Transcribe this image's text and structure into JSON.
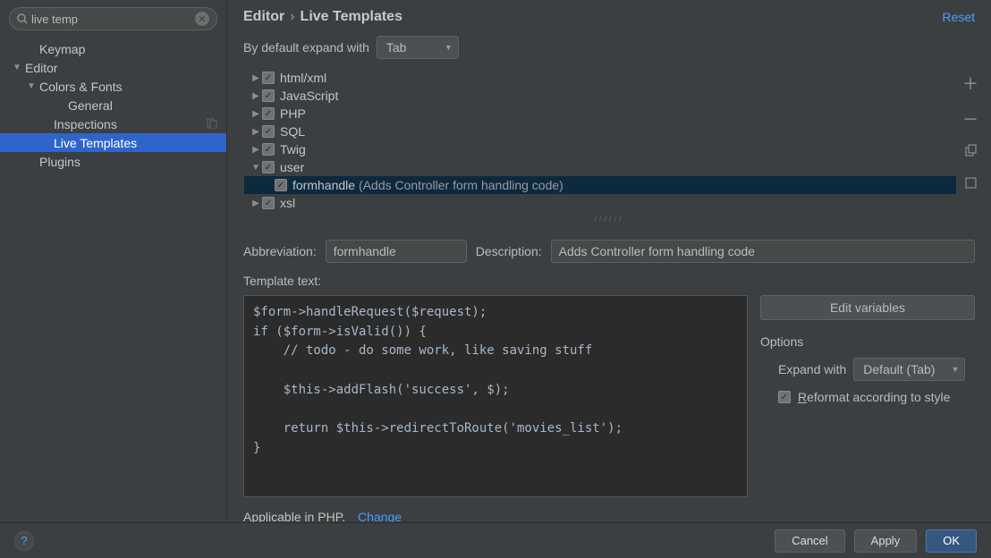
{
  "search": {
    "value": "live temp"
  },
  "sidebar": {
    "items": [
      {
        "label": "Keymap",
        "indent": 30,
        "arrow": ""
      },
      {
        "label": "Editor",
        "indent": 14,
        "arrow": "▼"
      },
      {
        "label": "Colors & Fonts",
        "indent": 30,
        "arrow": "▼"
      },
      {
        "label": "General",
        "indent": 62,
        "arrow": ""
      },
      {
        "label": "Inspections",
        "indent": 46,
        "arrow": "",
        "mod": true
      },
      {
        "label": "Live Templates",
        "indent": 46,
        "arrow": "",
        "selected": true
      },
      {
        "label": "Plugins",
        "indent": 30,
        "arrow": ""
      }
    ]
  },
  "breadcrumb": {
    "a": "Editor",
    "b": "Live Templates"
  },
  "reset": "Reset",
  "expand": {
    "label": "By default expand with",
    "value": "Tab"
  },
  "templates": [
    {
      "label": "html/xml",
      "arrow": "▶"
    },
    {
      "label": "JavaScript",
      "arrow": "▶"
    },
    {
      "label": "PHP",
      "arrow": "▶"
    },
    {
      "label": "SQL",
      "arrow": "▶"
    },
    {
      "label": "Twig",
      "arrow": "▶"
    },
    {
      "label": "user",
      "arrow": "▼"
    },
    {
      "label": "formhandle",
      "desc": "(Adds Controller form handling code)",
      "arrow": "",
      "child": true,
      "selected": true
    },
    {
      "label": "xsl",
      "arrow": "▶"
    }
  ],
  "form": {
    "abbrev_label": "Abbreviation:",
    "abbrev_value": "formhandle",
    "desc_label": "Description:",
    "desc_value": "Adds Controller form handling code",
    "template_text_label": "Template text:",
    "code": "$form->handleRequest($request);\nif ($form->isValid()) {\n    // todo - do some work, like saving stuff\n\n    $this->addFlash('success', $);\n\n    return $this->redirectToRoute('movies_list');\n}"
  },
  "right": {
    "edit_vars": "Edit variables",
    "options": "Options",
    "expand_with_label": "Expand with",
    "expand_with_value": "Default (Tab)",
    "reformat": "Reformat according to style"
  },
  "applicable": {
    "text": "Applicable in PHP.",
    "change": "Change"
  },
  "footer": {
    "cancel": "Cancel",
    "apply": "Apply",
    "ok": "OK"
  }
}
